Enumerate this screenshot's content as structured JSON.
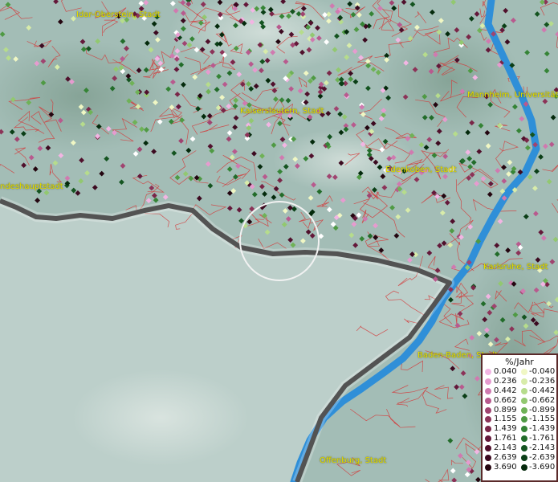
{
  "map": {
    "cities": [
      {
        "name": "Idar-Oberstein, Stadt"
      },
      {
        "name": "Kaiserslautern, Stadt"
      },
      {
        "name": "Mannheim, Universitäts"
      },
      {
        "name": "Edenkoben, Stadt"
      },
      {
        "name": "ndeshauptstadt"
      },
      {
        "name": "Karlsruhe, Stadt"
      },
      {
        "name": "Baden-Baden, Stadt"
      },
      {
        "name": "Offenburg, Stadt"
      }
    ],
    "colors": {
      "river": "#2f8fd8",
      "border": "#111111",
      "admin_lines": "#d43a3a",
      "label": "#e6e000",
      "cursor_ring": "#f2f2f2"
    }
  },
  "legend": {
    "title": "%/Jahr",
    "positive": [
      {
        "label": "0.040",
        "color": "#f2b5e3"
      },
      {
        "label": "0.236",
        "color": "#e69bcf"
      },
      {
        "label": "0.442",
        "color": "#d07ab0"
      },
      {
        "label": "0.662",
        "color": "#b85a8e"
      },
      {
        "label": "0.899",
        "color": "#a04470"
      },
      {
        "label": "1.155",
        "color": "#8c3358"
      },
      {
        "label": "1.439",
        "color": "#7a2648"
      },
      {
        "label": "1.761",
        "color": "#64183a"
      },
      {
        "label": "2.143",
        "color": "#50102c"
      },
      {
        "label": "2.639",
        "color": "#3c0a20"
      },
      {
        "label": "3.690",
        "color": "#240610"
      }
    ],
    "negative": [
      {
        "label": "-0.040",
        "color": "#f0f7c4"
      },
      {
        "label": "-0.236",
        "color": "#d8ecaa"
      },
      {
        "label": "-0.442",
        "color": "#b6dc8c"
      },
      {
        "label": "-0.662",
        "color": "#92c870"
      },
      {
        "label": "-0.899",
        "color": "#6fb257"
      },
      {
        "label": "-1.155",
        "color": "#4f9a44"
      },
      {
        "label": "-1.439",
        "color": "#358436"
      },
      {
        "label": "-1.761",
        "color": "#226c2a"
      },
      {
        "label": "-2.143",
        "color": "#145420"
      },
      {
        "label": "-2.639",
        "color": "#0a3e16"
      },
      {
        "label": "-3.690",
        "color": "#042a0c"
      }
    ]
  }
}
